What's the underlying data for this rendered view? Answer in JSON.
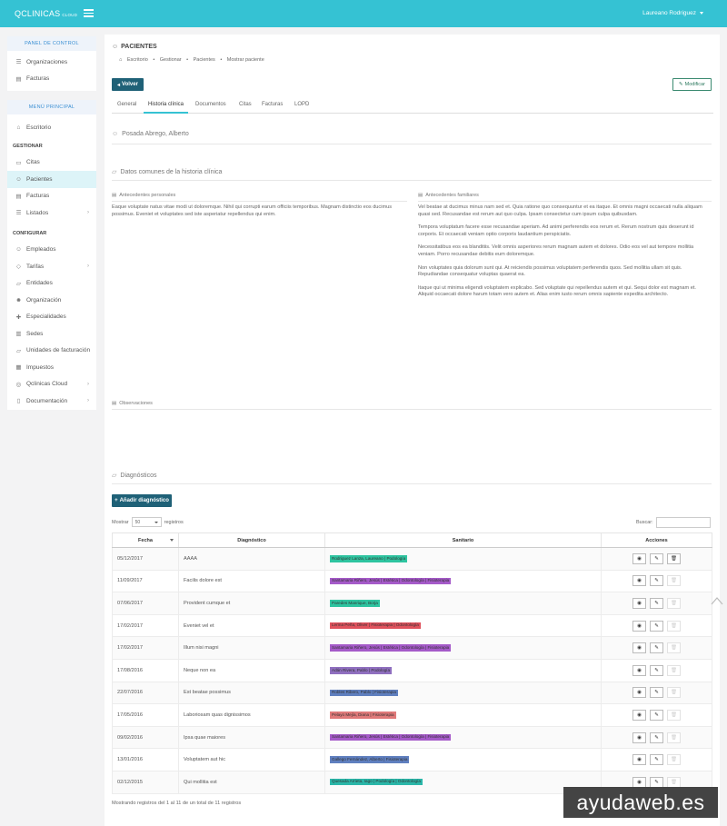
{
  "topbar": {
    "brand": "QCLINICAS",
    "brand_sub": "CLOUD",
    "user": "Laureano Rodriguez"
  },
  "panel_control": {
    "title": "PANEL DE CONTROL",
    "items": [
      {
        "label": "Organizaciones",
        "icon": "list-icon"
      },
      {
        "label": "Facturas",
        "icon": "document-icon"
      }
    ]
  },
  "menu_principal": {
    "title": "MENÚ PRINCIPAL",
    "escritorio": "Escritorio",
    "group_gestionar": "GESTIONAR",
    "gestionar": [
      "Citas",
      "Pacientes",
      "Facturas",
      "Listados"
    ],
    "group_configurar": "CONFIGURAR",
    "configurar": [
      "Empleados",
      "Tarifas",
      "Entidades",
      "Organización",
      "Especialidades",
      "Sedes",
      "Unidades de facturación",
      "Impuestos",
      "Qclinicas Cloud",
      "Documentación"
    ]
  },
  "page": {
    "title": "PACIENTES",
    "breadcrumb": [
      "Escritorio",
      "Gestionar",
      "Pacientes",
      "Mostrar paciente"
    ],
    "back_label": "Volver",
    "edit_label": "Modificar",
    "tabs": [
      "General",
      "Historia clínica",
      "Documentos",
      "Citas",
      "Facturas",
      "LOPD"
    ],
    "patient_name": "Posada Abrego, Alberto",
    "datos_title": "Datos comunes de la historia clínica",
    "personal_label": "Antecedentes personales",
    "personal_text": "Eaque voluptate natus vitae modi ut doloremque. Nihil qui corrupti earum officiis temporibus. Magnam distinctio eos ducimus possimus. Eveniet et voluptates sed iste asperiatur repellendus qui enim.",
    "family_label": "Antecedentes familiares",
    "family_paragraphs": [
      "Vel beatae at ducimus minus nam sed et. Quia ratione quo consequuntur et ea itaque. Et omnis magni occaecati nulla aliquam quasi sed. Recusandae est rerum aut quo culpa. Ipsam consectetur cum ipsum culpa quibusdam.",
      "Tempora voluptatum facere esse recusandae aperiam. Ad animi perferendis eos rerum et. Rerum nostrum quis deserunt id corporis. Et occaecati veniam optio corporis laudantium perspiciatis.",
      "Necessitatibus eos ea blanditiis. Velit omnis asperiores rerum magnam autem et dolores. Odio eos vel aut tempore mollitia veniam. Porro recusandae debitis eum doloremque.",
      "Non voluptates quia dolorum sunt qui. At reiciendis possimus voluptatem perferendis quos. Sed mollitia ullam sit quis. Repudiandae consequatur voluptas quaerat ea.",
      "Itaque qui ut minima eligendi voluptatem explicabo. Sed voluptate qui repellendus autem et qui. Sequi dolor est magnam et. Aliquid occaecati dolore harum totam vero autem et. Alias enim iusto rerum omnis sapiente expedita architecto."
    ],
    "observaciones_label": "Observaciones",
    "diagnosticos_title": "Diagnósticos",
    "add_diag_label": "Añadir diagnóstico",
    "show_label": "Mostrar",
    "show_value": "50",
    "records_label": "registros",
    "search_label": "Buscar:",
    "columns": [
      "Fecha",
      "Diagnóstico",
      "Sanitario",
      "Acciones"
    ],
    "rows": [
      {
        "fecha": "05/12/2017",
        "diag": "AAAA",
        "sanitario": "Rodriguez Lanza, Laureano | Podología",
        "color": "#2ec4a0",
        "deletable": true
      },
      {
        "fecha": "11/09/2017",
        "diag": "Facilis dolore est",
        "sanitario": "Santamaria Riñero, Jesús | Estética | Odontología | Fisioterapia",
        "color": "#a55ac9",
        "deletable": false
      },
      {
        "fecha": "07/06/2017",
        "diag": "Provident cumque et",
        "sanitario": "Paredes Manrique, Borja",
        "color": "#2ec4a0",
        "deletable": false
      },
      {
        "fecha": "17/02/2017",
        "diag": "Eveniet vel et",
        "sanitario": "Lerma Peña, Oliver | Fisioterapia | Odontología",
        "color": "#e0525d",
        "deletable": false
      },
      {
        "fecha": "17/02/2017",
        "diag": "Illum nisi magni",
        "sanitario": "Santamaria Riñero, Jesús | Estética | Odontología | Fisioterapia",
        "color": "#a55ac9",
        "deletable": false
      },
      {
        "fecha": "17/08/2016",
        "diag": "Neque non ea",
        "sanitario": "Adán Rivera, Pablo | Podología",
        "color": "#8f6fbf",
        "deletable": false
      },
      {
        "fecha": "22/07/2016",
        "diag": "Est beatae possimus",
        "sanitario": "Robles Ribero, Pablo | Fisioterapia",
        "color": "#5f7fbf",
        "deletable": false
      },
      {
        "fecha": "17/05/2016",
        "diag": "Laboriosam quas dignissimos",
        "sanitario": "Pelayo Mejía, Diana | Fisioterapia",
        "color": "#e07a7a",
        "deletable": false
      },
      {
        "fecha": "09/02/2016",
        "diag": "Ipsa quae maiores",
        "sanitario": "Santamaria Riñero, Jesús | Estética | Odontología | Fisioterapia",
        "color": "#a55ac9",
        "deletable": false
      },
      {
        "fecha": "13/01/2016",
        "diag": "Voluptatem aut hic",
        "sanitario": "Gallego Fernández, Alberto | Fisioterapia",
        "color": "#5f7fbf",
        "deletable": false
      },
      {
        "fecha": "02/12/2015",
        "diag": "Qui mollitia est",
        "sanitario": "Quesada Arrieta, Iago | Podología | Odontología",
        "color": "#2ab7a9",
        "deletable": false
      }
    ],
    "info": "Mostrando registros del 1 al 11 de un total de 11 registros"
  },
  "watermark": "ayudaweb.es"
}
